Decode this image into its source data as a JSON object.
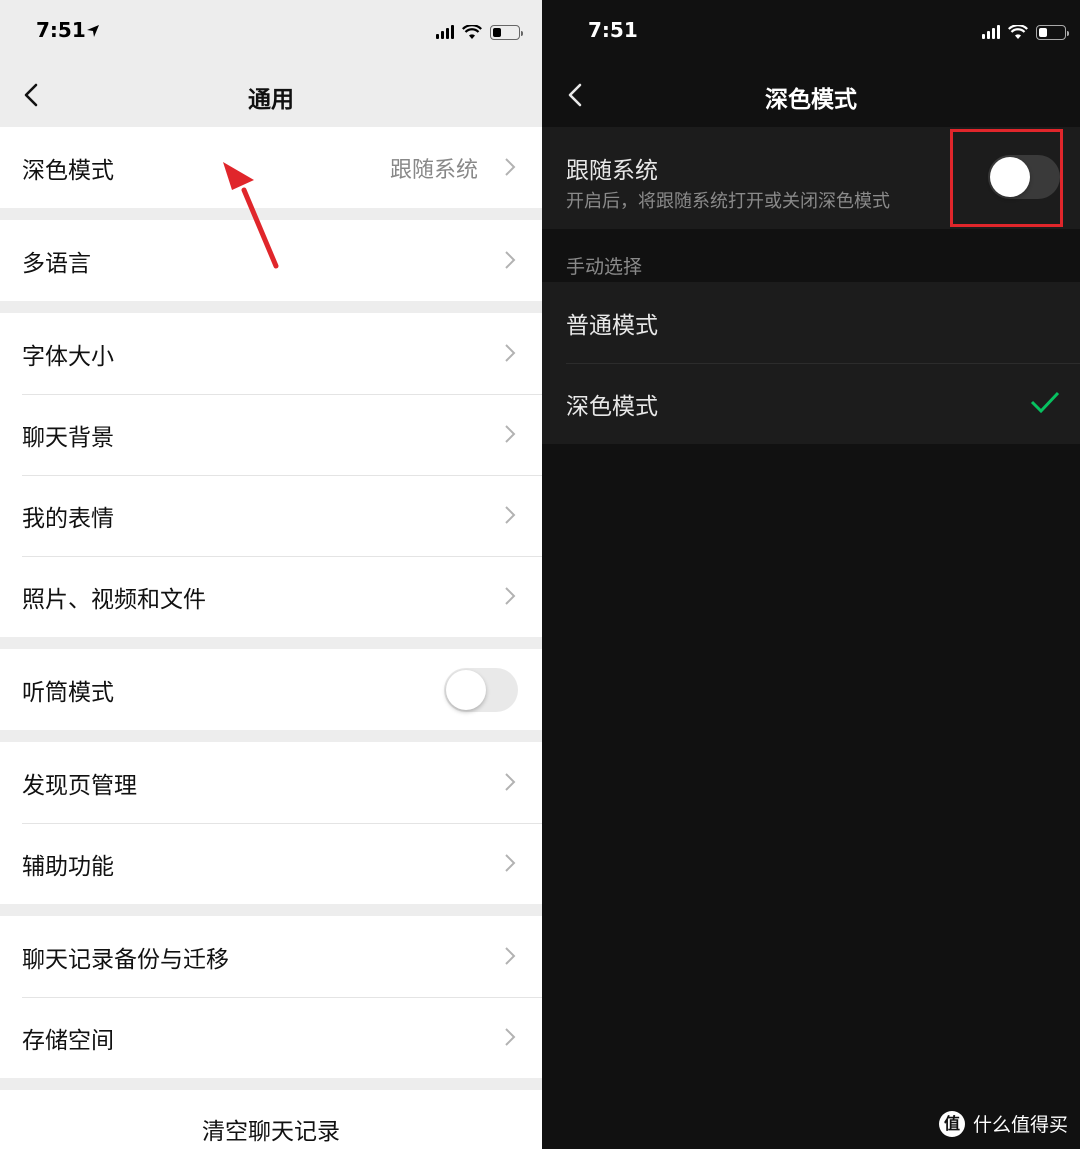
{
  "left": {
    "status": {
      "time": "7:51"
    },
    "nav": {
      "title": "通用"
    },
    "groups": [
      [
        {
          "label": "深色模式",
          "value": "跟随系统",
          "type": "link"
        }
      ],
      [
        {
          "label": "多语言",
          "type": "link"
        }
      ],
      [
        {
          "label": "字体大小",
          "type": "link"
        },
        {
          "label": "聊天背景",
          "type": "link"
        },
        {
          "label": "我的表情",
          "type": "link"
        },
        {
          "label": "照片、视频和文件",
          "type": "link"
        }
      ],
      [
        {
          "label": "听筒模式",
          "type": "toggle",
          "on": false
        }
      ],
      [
        {
          "label": "发现页管理",
          "type": "link"
        },
        {
          "label": "辅助功能",
          "type": "link"
        }
      ],
      [
        {
          "label": "聊天记录备份与迁移",
          "type": "link"
        },
        {
          "label": "存储空间",
          "type": "link"
        }
      ]
    ],
    "clear_label": "清空聊天记录"
  },
  "right": {
    "status": {
      "time": "7:51"
    },
    "nav": {
      "title": "深色模式"
    },
    "follow": {
      "title": "跟随系统",
      "desc": "开启后，将跟随系统打开或关闭深色模式",
      "on": false
    },
    "manual_header": "手动选择",
    "options": [
      {
        "label": "普通模式",
        "selected": false
      },
      {
        "label": "深色模式",
        "selected": true
      }
    ]
  },
  "watermark": {
    "logo": "值",
    "text": "什么值得买"
  },
  "colors": {
    "annotation_red": "#e0262b",
    "check_green": "#07c160"
  }
}
